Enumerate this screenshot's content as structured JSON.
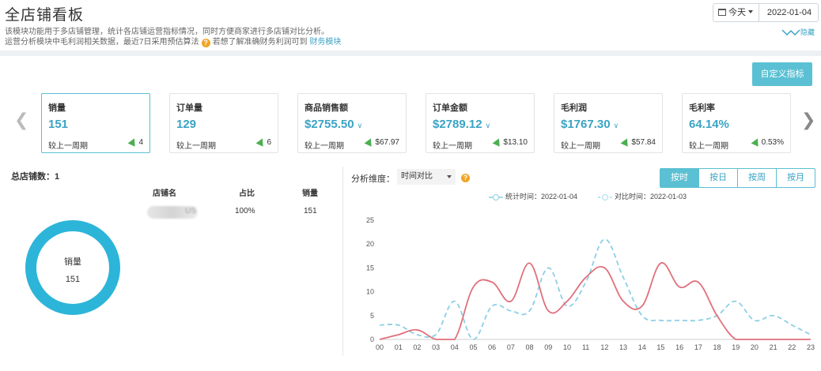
{
  "header": {
    "title": "全店铺看板",
    "desc_line1": "该模块功能用于多店铺管理，统计各店铺运营指标情况，同时方便商家进行多店铺对比分析。",
    "desc_line2_prefix": "运营分析模块中毛利润相关数据，最近7日采用预估算法",
    "desc_line2_suffix": "若想了解准确财务利润可到",
    "desc_link": "财务模块",
    "period": "今天",
    "date": "2022-01-04",
    "hide_label": "隐藏"
  },
  "toolbar": {
    "custom_metrics": "自定义指标"
  },
  "cards": [
    {
      "label": "销量",
      "value": "151",
      "has_chevron": false,
      "compare": "较上一周期",
      "delta": "4"
    },
    {
      "label": "订单量",
      "value": "129",
      "has_chevron": false,
      "compare": "较上一周期",
      "delta": "6"
    },
    {
      "label": "商品销售额",
      "value": "$2755.50",
      "has_chevron": true,
      "compare": "较上一周期",
      "delta": "$67.97"
    },
    {
      "label": "订单金额",
      "value": "$2789.12",
      "has_chevron": true,
      "compare": "较上一周期",
      "delta": "$13.10"
    },
    {
      "label": "毛利润",
      "value": "$1767.30",
      "has_chevron": true,
      "compare": "较上一周期",
      "delta": "$57.84"
    },
    {
      "label": "毛利率",
      "value": "64.14%",
      "has_chevron": false,
      "compare": "较上一周期",
      "delta": "0.53%"
    }
  ],
  "stores": {
    "total_label": "总店铺数：1",
    "columns": [
      "店铺名",
      "占比",
      "销量"
    ],
    "rows": [
      {
        "name_suffix": "US",
        "share": "100%",
        "sales": "151"
      }
    ],
    "donut_label": "销量",
    "donut_value": "151"
  },
  "analysis": {
    "dimension_label": "分析维度：",
    "dimension_value": "时间对比",
    "tabs": [
      "按时",
      "按日",
      "按周",
      "按月"
    ],
    "active_tab": 0
  },
  "colors": {
    "accent": "#5bc0d3",
    "current_series": "#e0707c",
    "compare_series": "#8ccfe6",
    "up": "#4caf50"
  },
  "chart_data": {
    "type": "line",
    "x": [
      "00",
      "01",
      "02",
      "03",
      "04",
      "05",
      "06",
      "07",
      "08",
      "09",
      "10",
      "11",
      "12",
      "13",
      "14",
      "15",
      "16",
      "17",
      "18",
      "19",
      "20",
      "21",
      "22",
      "23"
    ],
    "ylim": [
      0,
      25
    ],
    "yticks": [
      0,
      5,
      10,
      15,
      20,
      25
    ],
    "legend_position": "top",
    "grid": false,
    "series": [
      {
        "name": "统计时间：2022-01-04",
        "style": "solid",
        "values": [
          0,
          1,
          2,
          0,
          0,
          11,
          12,
          8,
          16,
          6,
          8,
          13,
          15,
          8,
          7,
          16,
          11,
          12,
          5,
          0,
          0,
          0,
          0,
          0
        ]
      },
      {
        "name": "对比时间：2022-01-03",
        "style": "dashed",
        "values": [
          3,
          3,
          1,
          1,
          8,
          0,
          7,
          6,
          6,
          15,
          7,
          12,
          21,
          13,
          5,
          4,
          4,
          4,
          5,
          8,
          4,
          5,
          3,
          1
        ]
      }
    ]
  }
}
